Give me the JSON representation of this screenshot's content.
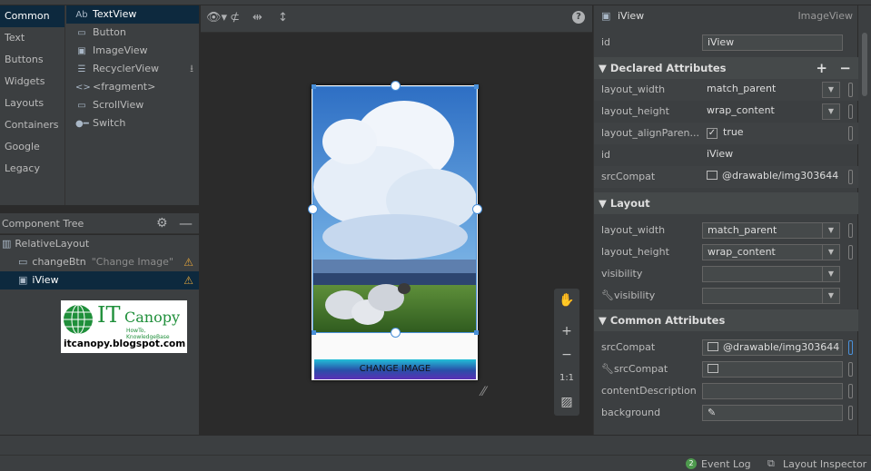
{
  "palette": {
    "categories": [
      "Common",
      "Text",
      "Buttons",
      "Widgets",
      "Layouts",
      "Containers",
      "Google",
      "Legacy"
    ],
    "items": [
      {
        "icon": "Ab",
        "label": "TextView"
      },
      {
        "icon": "▭",
        "label": "Button"
      },
      {
        "icon": "▣",
        "label": "ImageView"
      },
      {
        "icon": "☰",
        "label": "RecyclerView"
      },
      {
        "icon": "<>",
        "label": "<fragment>"
      },
      {
        "icon": "▭",
        "label": "ScrollView"
      },
      {
        "icon": "●━",
        "label": "Switch"
      }
    ]
  },
  "component_tree": {
    "title": "Component Tree",
    "nodes": [
      {
        "label": "RelativeLayout",
        "hint": ""
      },
      {
        "label": "changeBtn",
        "hint": "\"Change Image\""
      },
      {
        "label": "iView",
        "hint": ""
      }
    ]
  },
  "logo": {
    "brand_it": "IT",
    "brand_canopy": "Canopy",
    "tagline": "HowTo, KnowledgeBase",
    "url": "itcanopy.blogspot.com"
  },
  "canvas": {
    "button_label": "CHANGE IMAGE",
    "zoom_fit": "1:1"
  },
  "attributes": {
    "header_name": "iView",
    "header_type": "ImageView",
    "id_label": "id",
    "id_value": "iView",
    "declared": {
      "title": "Declared Attributes",
      "rows": [
        {
          "label": "layout_width",
          "value": "match_parent"
        },
        {
          "label": "layout_height",
          "value": "wrap_content"
        },
        {
          "label": "layout_alignParen...",
          "value": "true"
        },
        {
          "label": "id",
          "value": "iView"
        },
        {
          "label": "srcCompat",
          "value": "@drawable/img303644"
        }
      ]
    },
    "layout": {
      "title": "Layout",
      "rows": [
        {
          "label": "layout_width",
          "value": "match_parent"
        },
        {
          "label": "layout_height",
          "value": "wrap_content"
        },
        {
          "label": "visibility",
          "value": ""
        },
        {
          "label": "visibility",
          "value": ""
        }
      ]
    },
    "common": {
      "title": "Common Attributes",
      "rows": [
        {
          "label": "srcCompat",
          "value": "@drawable/img303644"
        },
        {
          "label": "srcCompat",
          "value": ""
        },
        {
          "label": "contentDescription",
          "value": ""
        },
        {
          "label": "background",
          "value": ""
        }
      ]
    }
  },
  "statusbar": {
    "event_count": "2",
    "event_log": "Event Log",
    "layout_inspector": "Layout Inspector"
  },
  "colors": {
    "panel_bg": "#3c3f41",
    "editor_bg": "#2b2b2b",
    "selection": "#0d293e",
    "accent_blue": "#4a90d9",
    "warning": "#e0a33c"
  }
}
